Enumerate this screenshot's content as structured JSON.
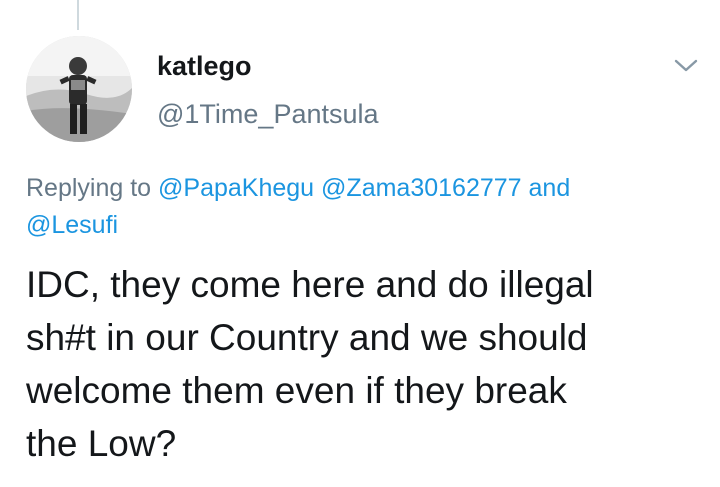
{
  "author": {
    "display_name": "katlego",
    "handle": "@1Time_Pantsula"
  },
  "icons": {
    "more": "chevron-down-icon",
    "avatar": "avatar-photo"
  },
  "reply": {
    "prefix": "Replying to",
    "mentions": [
      "@PapaKhegu",
      "@Zama30162777",
      "@Lesufi"
    ],
    "conjunction": "and"
  },
  "tweet": {
    "lines": [
      "IDC, they come here and do illegal",
      "sh#t in our Country and we should",
      "welcome them even if they break",
      "the Low?"
    ]
  },
  "colors": {
    "text": "#14171a",
    "muted": "#657786",
    "link": "#1b95e0",
    "thread_line": "#cfd9de"
  }
}
